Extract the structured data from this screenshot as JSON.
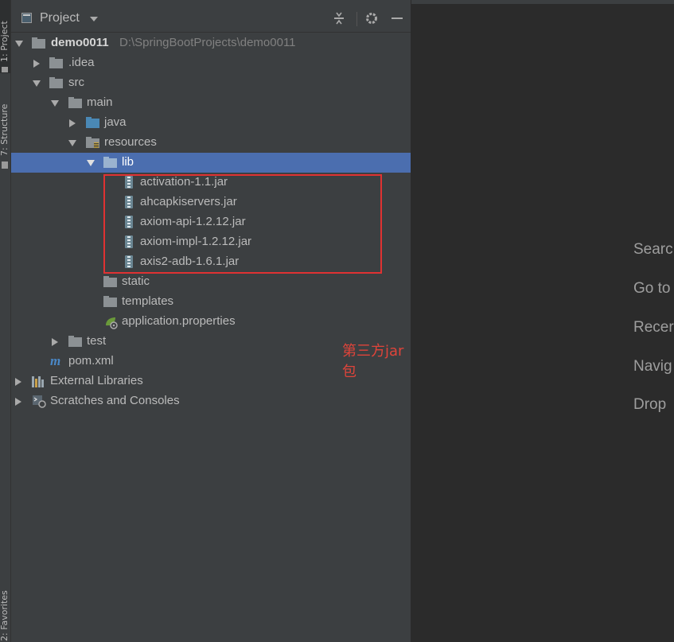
{
  "tool_strip": {
    "project_tab": "1: Project",
    "structure_tab": "7: Structure",
    "favorites_tab": "2: Favorites"
  },
  "panel": {
    "title": "Project",
    "buttons": [
      "collapse-icon",
      "gear-icon",
      "minimize-icon"
    ]
  },
  "tree": {
    "root": {
      "label": "demo0011",
      "path": "D:\\SpringBootProjects\\demo0011"
    },
    "idea": ".idea",
    "src": "src",
    "main": "main",
    "java": "java",
    "resources": "resources",
    "lib": "lib",
    "jars": [
      "activation-1.1.jar",
      "ahcapkiservers.jar",
      "axiom-api-1.2.12.jar",
      "axiom-impl-1.2.12.jar",
      "axis2-adb-1.6.1.jar"
    ],
    "static": "static",
    "templates": "templates",
    "app_props": "application.properties",
    "test": "test",
    "pom": "pom.xml",
    "external_libraries": "External Libraries",
    "scratches": "Scratches and Consoles"
  },
  "annotation": "第三方jar包",
  "editor_hints": [
    "Searc",
    "Go to",
    "Recer",
    "Navig",
    "Drop"
  ],
  "colors": {
    "panel_bg": "#3c3f41",
    "editor_bg": "#2b2b2b",
    "selection": "#4b6eaf",
    "annotation_red": "#e03232"
  }
}
